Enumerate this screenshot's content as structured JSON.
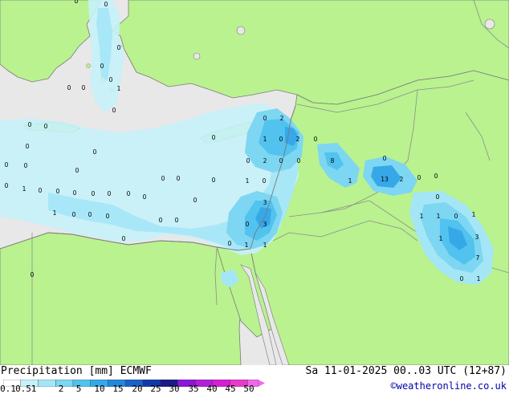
{
  "title": {
    "left": "Precipitation [mm] ECMWF",
    "right": "Sa 11-01-2025 00..03 UTC (12+87)"
  },
  "credit": "©weatheronline.co.uk",
  "legend": {
    "labels": [
      "0.1",
      "0.5",
      "1",
      "2",
      "5",
      "10",
      "15",
      "20",
      "25",
      "30",
      "35",
      "40",
      "45",
      "50"
    ],
    "colors": [
      "#ffffff",
      "#c6f1fa",
      "#a4e6f6",
      "#7dd6f2",
      "#52c2ee",
      "#36a8e8",
      "#2487dc",
      "#1a62c8",
      "#0f3ba8",
      "#1a1a88",
      "#8b16d8",
      "#b21fd8",
      "#d41ed2",
      "#e83acc",
      "#f06ae6"
    ]
  },
  "colors": {
    "land": "#b9f28f",
    "sea": "#e8e8e8",
    "border": "#8c8c8c",
    "coast": "#7a7a7a"
  },
  "map_labels": [
    {
      "id": "cyprus-w",
      "text": "0"
    },
    {
      "id": "lebanon-1",
      "text": "0"
    },
    {
      "id": "lebanon-2",
      "text": "2"
    },
    {
      "id": "syria-1",
      "text": "1"
    },
    {
      "id": "syria-2",
      "text": "0"
    },
    {
      "id": "syria-3",
      "text": "2"
    },
    {
      "id": "syria-4",
      "text": "0"
    },
    {
      "id": "coast-1",
      "text": "0"
    },
    {
      "id": "coast-2",
      "text": "2"
    },
    {
      "id": "coast-3",
      "text": "0"
    },
    {
      "id": "coast-4",
      "text": "0"
    },
    {
      "id": "inland-1",
      "text": "8"
    },
    {
      "id": "inland-2",
      "text": "1"
    },
    {
      "id": "iraq-1",
      "text": "0"
    },
    {
      "id": "iraq-2",
      "text": "13"
    },
    {
      "id": "iraq-3",
      "text": "2"
    },
    {
      "id": "iraq-4",
      "text": "0"
    },
    {
      "id": "iraq-5",
      "text": "0"
    },
    {
      "id": "iraq-6",
      "text": "0"
    },
    {
      "id": "iraq-7",
      "text": "1"
    },
    {
      "id": "iraq-8",
      "text": "1"
    },
    {
      "id": "iraq-9",
      "text": "0"
    },
    {
      "id": "iraq-10",
      "text": "1"
    },
    {
      "id": "iraq-11",
      "text": "3"
    },
    {
      "id": "iraq-12",
      "text": "1"
    },
    {
      "id": "iraq-13",
      "text": "7"
    },
    {
      "id": "iraq-14",
      "text": "0"
    },
    {
      "id": "iraq-15",
      "text": "1"
    },
    {
      "id": "israel-1",
      "text": "1"
    },
    {
      "id": "israel-2",
      "text": "0"
    },
    {
      "id": "israel-3",
      "text": "3"
    },
    {
      "id": "israel-4",
      "text": "0"
    },
    {
      "id": "israel-5",
      "text": "3"
    },
    {
      "id": "israel-6",
      "text": "0"
    },
    {
      "id": "israel-7",
      "text": "1"
    },
    {
      "id": "israel-8",
      "text": "1"
    },
    {
      "id": "sea-1",
      "text": "0"
    },
    {
      "id": "sea-2",
      "text": "1"
    },
    {
      "id": "sea-3",
      "text": "0"
    },
    {
      "id": "sea-4",
      "text": "0"
    },
    {
      "id": "sea-5",
      "text": "0"
    },
    {
      "id": "sea-6",
      "text": "0"
    },
    {
      "id": "sea-7",
      "text": "0"
    },
    {
      "id": "sea-8",
      "text": "0"
    },
    {
      "id": "sea-9",
      "text": "0"
    },
    {
      "id": "sea-10",
      "text": "0"
    },
    {
      "id": "sea-11",
      "text": "0"
    },
    {
      "id": "sea-12",
      "text": "1"
    },
    {
      "id": "sea-13",
      "text": "0"
    },
    {
      "id": "sea-14",
      "text": "0"
    },
    {
      "id": "sea-15",
      "text": "0"
    },
    {
      "id": "sea-16",
      "text": "0"
    },
    {
      "id": "sea-17",
      "text": "0"
    },
    {
      "id": "sea-18",
      "text": "0"
    },
    {
      "id": "sea-19",
      "text": "0"
    },
    {
      "id": "sea-20",
      "text": "0"
    },
    {
      "id": "sea-21",
      "text": "0"
    },
    {
      "id": "sea-22",
      "text": "0"
    },
    {
      "id": "sea-23",
      "text": "0"
    },
    {
      "id": "sea-24",
      "text": "0"
    },
    {
      "id": "sea-25",
      "text": "0"
    },
    {
      "id": "aegean-1",
      "text": "0"
    },
    {
      "id": "aegean-2",
      "text": "0"
    },
    {
      "id": "aegean-3",
      "text": "0"
    },
    {
      "id": "aegean-4",
      "text": "0"
    },
    {
      "id": "aegean-5",
      "text": "0"
    },
    {
      "id": "aegean-6",
      "text": "0"
    },
    {
      "id": "aegean-7",
      "text": "0"
    },
    {
      "id": "aegean-8",
      "text": "1"
    },
    {
      "id": "aegean-9",
      "text": "0"
    },
    {
      "id": "crete-1",
      "text": "0"
    },
    {
      "id": "crete-2",
      "text": "0"
    },
    {
      "id": "egypt-1",
      "text": "0"
    }
  ]
}
